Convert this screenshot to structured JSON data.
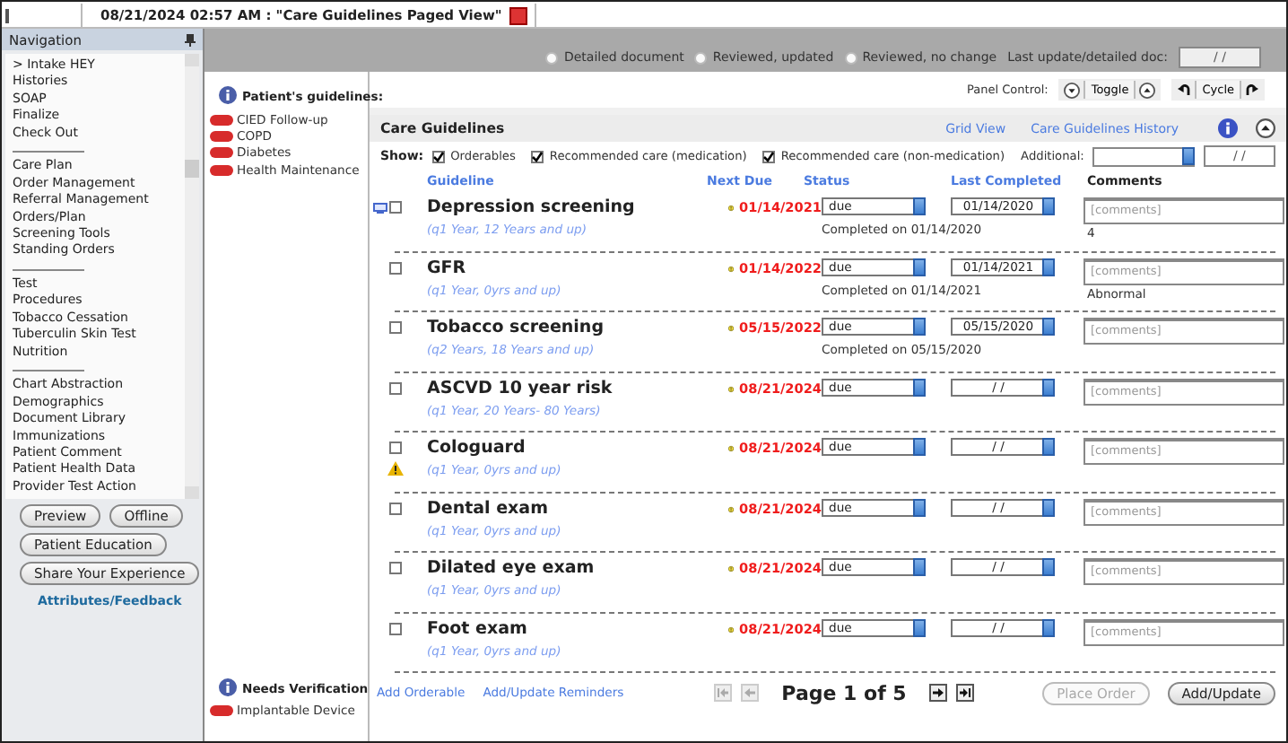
{
  "window": {
    "title": "08/21/2024 02:57 AM : \"Care Guidelines Paged View\""
  },
  "navigation": {
    "title": "Navigation",
    "items": [
      {
        "kind": "item",
        "label": "> Intake HEY"
      },
      {
        "kind": "item",
        "label": "Histories"
      },
      {
        "kind": "item",
        "label": "SOAP"
      },
      {
        "kind": "item",
        "label": "Finalize"
      },
      {
        "kind": "item",
        "label": "Check Out"
      },
      {
        "kind": "separator"
      },
      {
        "kind": "item",
        "label": "Care Plan"
      },
      {
        "kind": "item",
        "label": "Order Management"
      },
      {
        "kind": "item",
        "label": "Referral Management"
      },
      {
        "kind": "item",
        "label": "Orders/Plan"
      },
      {
        "kind": "item",
        "label": "Screening Tools"
      },
      {
        "kind": "item",
        "label": "Standing Orders"
      },
      {
        "kind": "separator"
      },
      {
        "kind": "item",
        "label": "Test"
      },
      {
        "kind": "item",
        "label": "Procedures"
      },
      {
        "kind": "item",
        "label": "Tobacco Cessation"
      },
      {
        "kind": "item",
        "label": "Tuberculin Skin Test"
      },
      {
        "kind": "item",
        "label": "Nutrition"
      },
      {
        "kind": "separator"
      },
      {
        "kind": "item",
        "label": "Chart Abstraction"
      },
      {
        "kind": "item",
        "label": "Demographics"
      },
      {
        "kind": "item",
        "label": "Document Library"
      },
      {
        "kind": "item",
        "label": "Immunizations"
      },
      {
        "kind": "item",
        "label": "Patient Comment"
      },
      {
        "kind": "item",
        "label": "Patient Health Data"
      },
      {
        "kind": "item",
        "label": "Provider Test Action"
      }
    ],
    "buttons": [
      [
        "Preview",
        "Offline"
      ],
      [
        "Patient Education"
      ],
      [
        "Share Your Experience"
      ]
    ],
    "link": "Attributes/Feedback"
  },
  "patient_guidelines": {
    "title": "Patient's guidelines:",
    "items": [
      "CIED Follow-up",
      "COPD",
      "Diabetes",
      "Health Maintenance"
    ]
  },
  "needs_verification": {
    "title": "Needs Verification",
    "items": [
      "Implantable Device"
    ]
  },
  "review": {
    "options": [
      {
        "label": "Detailed document",
        "selected": false
      },
      {
        "label": "Reviewed, updated",
        "selected": false
      },
      {
        "label": "Reviewed, no change",
        "selected": false
      }
    ],
    "date_label": "Last update/detailed doc:",
    "date_value": "/ /"
  },
  "panel_control": {
    "label": "Panel Control:",
    "toggle": "Toggle",
    "cycle": "Cycle"
  },
  "care_guidelines": {
    "title": "Care Guidelines",
    "links": [
      "Grid View",
      "Care Guidelines History"
    ],
    "show_label": "Show:",
    "filters": [
      {
        "label": "Orderables",
        "checked": true
      },
      {
        "label": "Recommended care (medication)",
        "checked": true
      },
      {
        "label": "Recommended care (non-medication)",
        "checked": true
      }
    ],
    "additional_label": "Additional:",
    "additional_date": "/ /",
    "columns": [
      "Guideline",
      "Next Due",
      "Status",
      "Last Completed",
      "Comments"
    ],
    "rows": [
      {
        "name": "Depression screening",
        "frequency": "(q1 Year, 12 Years and up)",
        "next_due": "01/14/2021",
        "status": "due",
        "last_completed": "01/14/2020",
        "completed_note": "Completed on 01/14/2020",
        "result": "4",
        "checked": false,
        "document_icon": true,
        "warning": false,
        "comment_placeholder": "[comments]"
      },
      {
        "name": "GFR",
        "frequency": "(q1 Year, 0yrs and up)",
        "next_due": "01/14/2022",
        "status": "due",
        "last_completed": "01/14/2021",
        "completed_note": "Completed on 01/14/2021",
        "result": "Abnormal",
        "checked": false,
        "document_icon": false,
        "warning": false,
        "comment_placeholder": "[comments]"
      },
      {
        "name": "Tobacco screening",
        "frequency": "(q2 Years, 18 Years and up)",
        "next_due": "05/15/2022",
        "status": "due",
        "last_completed": "05/15/2020",
        "completed_note": "Completed on 05/15/2020",
        "checked": false,
        "document_icon": false,
        "warning": false,
        "comment_placeholder": "[comments]"
      },
      {
        "name": "ASCVD 10 year risk",
        "frequency": "(q1 Year, 20 Years- 80 Years)",
        "next_due": "08/21/2024",
        "status": "due",
        "last_completed": "/ /",
        "checked": false,
        "document_icon": false,
        "warning": false,
        "comment_placeholder": "[comments]"
      },
      {
        "name": "Cologuard",
        "frequency": "(q1 Year, 0yrs and up)",
        "next_due": "08/21/2024",
        "status": "due",
        "last_completed": "/ /",
        "checked": false,
        "document_icon": false,
        "warning": true,
        "comment_placeholder": "[comments]"
      },
      {
        "name": "Dental exam",
        "frequency": "(q1 Year, 0yrs and up)",
        "next_due": "08/21/2024",
        "status": "due",
        "last_completed": "/ /",
        "checked": false,
        "document_icon": false,
        "warning": false,
        "comment_placeholder": "[comments]"
      },
      {
        "name": "Dilated eye exam",
        "frequency": "(q1 Year, 0yrs and up)",
        "next_due": "08/21/2024",
        "status": "due",
        "last_completed": "/ /",
        "checked": false,
        "document_icon": false,
        "warning": false,
        "comment_placeholder": "[comments]"
      },
      {
        "name": "Foot exam",
        "frequency": "(q1 Year, 0yrs and up)",
        "next_due": "08/21/2024",
        "status": "due",
        "last_completed": "/ /",
        "checked": false,
        "document_icon": false,
        "warning": false,
        "comment_placeholder": "[comments]"
      }
    ],
    "footer_links": [
      "Add Orderable",
      "Add/Update Reminders"
    ],
    "pager": "Page 1 of 5",
    "place_order": {
      "label": "Place Order",
      "disabled": true
    },
    "add_update": {
      "label": "Add/Update",
      "disabled": false
    }
  }
}
